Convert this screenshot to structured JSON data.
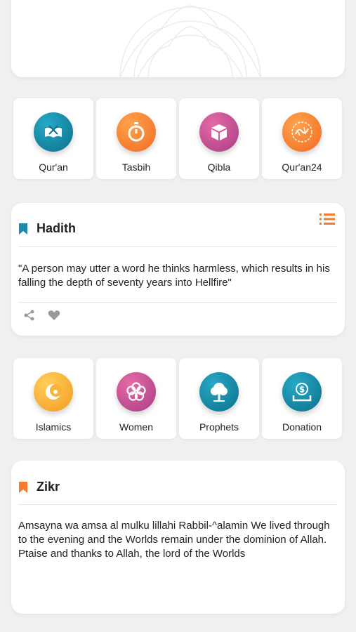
{
  "colors": {
    "accent_teal": "#1a8aa8",
    "accent_orange": "#f37b2b",
    "background": "#f0f0f0"
  },
  "top_grid": [
    {
      "label": "Qur'an",
      "icon": "quran-book-icon"
    },
    {
      "label": "Tasbih",
      "icon": "stopwatch-icon"
    },
    {
      "label": "Qibla",
      "icon": "kaaba-icon"
    },
    {
      "label": "Qur'an24",
      "icon": "calligraphy-icon"
    }
  ],
  "hadith": {
    "title": "Hadith",
    "text": "\"A person may utter a word he thinks harmless, which results in his falling the depth of seventy years into Hellfire\""
  },
  "bottom_grid": [
    {
      "label": "Islamics",
      "icon": "crescent-icon"
    },
    {
      "label": "Women",
      "icon": "flower-icon"
    },
    {
      "label": "Prophets",
      "icon": "tree-icon"
    },
    {
      "label": "Donation",
      "icon": "donation-icon"
    }
  ],
  "zikr": {
    "title": "Zikr",
    "text": "Amsayna wa amsa al mulku lillahi Rabbil-^alamin We lived through to the evening and the Worlds remain under the dominion of Allah. Ptaise and thanks to Allah, the lord of the Worlds"
  }
}
